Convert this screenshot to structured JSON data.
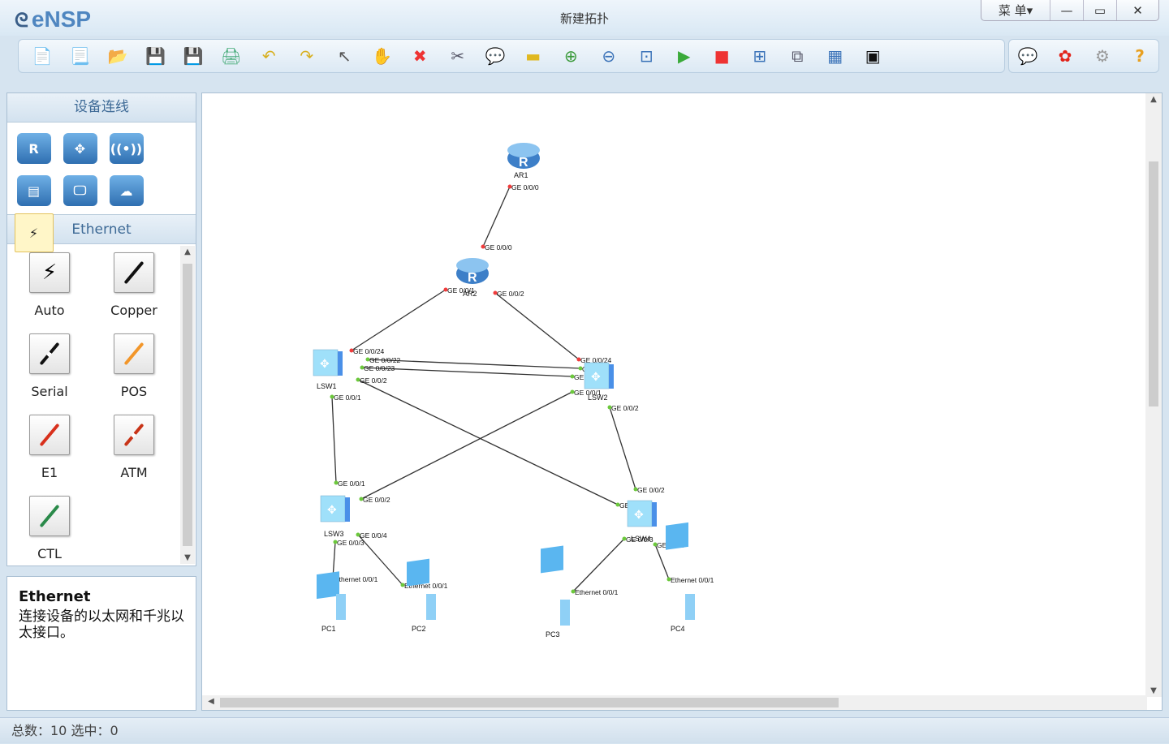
{
  "window": {
    "app_name": "eNSP",
    "title": "新建拓扑",
    "menu_label": "菜 单▾",
    "minimize": "—",
    "maximize": "▭",
    "close": "✕"
  },
  "toolbar": {
    "items": [
      {
        "name": "new-topology-icon",
        "glyph": "📄",
        "color": "#4a7"
      },
      {
        "name": "new-template-icon",
        "glyph": "📃",
        "color": "#4a7"
      },
      {
        "name": "open-icon",
        "glyph": "📂",
        "color": "#d9a93c"
      },
      {
        "name": "save-icon",
        "glyph": "💾",
        "color": "#3a72b8"
      },
      {
        "name": "save-as-icon",
        "glyph": "💾",
        "color": "#3a72b8"
      },
      {
        "name": "print-icon",
        "glyph": "🖨",
        "color": "#4a7"
      },
      {
        "name": "undo-icon",
        "glyph": "↶",
        "color": "#d8b020"
      },
      {
        "name": "redo-icon",
        "glyph": "↷",
        "color": "#d8b020"
      },
      {
        "name": "select-pointer-icon",
        "glyph": "↖",
        "color": "#555"
      },
      {
        "name": "hand-pan-icon",
        "glyph": "✋",
        "color": "#d9a070"
      },
      {
        "name": "delete-icon",
        "glyph": "✖",
        "color": "#e33"
      },
      {
        "name": "delete-link-icon",
        "glyph": "✂",
        "color": "#556"
      },
      {
        "name": "text-note-icon",
        "glyph": "💬",
        "color": "#58a"
      },
      {
        "name": "rectangle-icon",
        "glyph": "▬",
        "color": "#e0b820"
      },
      {
        "name": "zoom-in-icon",
        "glyph": "⊕",
        "color": "#3a9a3a"
      },
      {
        "name": "zoom-out-icon",
        "glyph": "⊖",
        "color": "#3a72b8"
      },
      {
        "name": "fit-view-icon",
        "glyph": "⊡",
        "color": "#3a72b8"
      },
      {
        "name": "start-device-icon",
        "glyph": "▶",
        "color": "#3aaa3a"
      },
      {
        "name": "stop-device-icon",
        "glyph": "■",
        "color": "#e33"
      },
      {
        "name": "capture-icon",
        "glyph": "⊞",
        "color": "#3a72b8"
      },
      {
        "name": "topology-tree-icon",
        "glyph": "⧉",
        "color": "#556"
      },
      {
        "name": "grid-icon",
        "glyph": "▦",
        "color": "#3a72b8"
      },
      {
        "name": "terminal-icon",
        "glyph": "▣",
        "color": "#111"
      }
    ],
    "right_items": [
      {
        "name": "chat-icon",
        "glyph": "💬",
        "color": "#58a"
      },
      {
        "name": "huawei-icon",
        "glyph": "✿",
        "color": "#e2231a"
      },
      {
        "name": "settings-gear-icon",
        "glyph": "⚙",
        "color": "#999"
      },
      {
        "name": "help-icon",
        "glyph": "?",
        "color": "#e8a020"
      }
    ]
  },
  "left_panel": {
    "title": "设备连线",
    "categories": [
      {
        "name": "router",
        "glyph": "R"
      },
      {
        "name": "switch",
        "glyph": "✥"
      },
      {
        "name": "wireless",
        "glyph": "((•))"
      },
      {
        "name": "firewall",
        "glyph": "▤"
      },
      {
        "name": "terminal",
        "glyph": "🖵"
      },
      {
        "name": "cloud",
        "glyph": "☁"
      },
      {
        "name": "cable",
        "glyph": "⚡"
      }
    ],
    "section_title": "Ethernet",
    "cables": [
      {
        "label": "Auto",
        "color": "#111"
      },
      {
        "label": "Copper",
        "color": "#111"
      },
      {
        "label": "Serial",
        "color": "#111"
      },
      {
        "label": "POS",
        "color": "#f2962a"
      },
      {
        "label": "E1",
        "color": "#d8301c"
      },
      {
        "label": "ATM",
        "color": "#c83418"
      },
      {
        "label": "CTL",
        "color": "#2a8a4a"
      }
    ],
    "description": {
      "title": "Ethernet",
      "text": "连接设备的以太网和千兆以太接口。"
    }
  },
  "topology": {
    "devices": [
      {
        "id": "AR1",
        "type": "router"
      },
      {
        "id": "AR2",
        "type": "router"
      },
      {
        "id": "LSW1",
        "type": "switch"
      },
      {
        "id": "LSW2",
        "type": "switch"
      },
      {
        "id": "LSW3",
        "type": "switch"
      },
      {
        "id": "LSW4",
        "type": "switch"
      },
      {
        "id": "PC1",
        "type": "pc"
      },
      {
        "id": "PC2",
        "type": "pc"
      },
      {
        "id": "PC3",
        "type": "pc"
      },
      {
        "id": "PC4",
        "type": "pc"
      }
    ],
    "links": [
      {
        "a": "AR1",
        "a_port": "GE 0/0/0",
        "b": "AR2",
        "b_port": "GE 0/0/0",
        "status": "down"
      },
      {
        "a": "AR2",
        "a_port": "GE 0/0/1",
        "b": "LSW1",
        "b_port": "GE 0/0/24",
        "status": "down"
      },
      {
        "a": "AR2",
        "a_port": "GE 0/0/2",
        "b": "LSW2",
        "b_port": "GE 0/0/24",
        "status": "down"
      },
      {
        "a": "LSW1",
        "a_port": "GE 0/0/22",
        "b": "LSW2",
        "b_port": "GE 0/0/22",
        "status": "up"
      },
      {
        "a": "LSW1",
        "a_port": "GE 0/0/23",
        "b": "LSW2",
        "b_port": "GE 0/0/23",
        "status": "up"
      },
      {
        "a": "LSW1",
        "a_port": "GE 0/0/2",
        "b": "LSW4",
        "b_port": "GE 0/0/1",
        "status": "up"
      },
      {
        "a": "LSW1",
        "a_port": "GE 0/0/1",
        "b": "LSW3",
        "b_port": "GE 0/0/1",
        "status": "up"
      },
      {
        "a": "LSW2",
        "a_port": "GE 0/0/1",
        "b": "LSW3",
        "b_port": "GE 0/0/2",
        "status": "up"
      },
      {
        "a": "LSW2",
        "a_port": "GE 0/0/2",
        "b": "LSW4",
        "b_port": "GE 0/0/2",
        "status": "up"
      },
      {
        "a": "LSW3",
        "a_port": "GE 0/0/3",
        "b": "PC1",
        "b_port": "Ethernet 0/0/1",
        "status": "up"
      },
      {
        "a": "LSW3",
        "a_port": "GE 0/0/4",
        "b": "PC2",
        "b_port": "Ethernet 0/0/1",
        "status": "up"
      },
      {
        "a": "LSW4",
        "a_port": "GE 0/0/3",
        "b": "PC3",
        "b_port": "Ethernet 0/0/1",
        "status": "up"
      },
      {
        "a": "LSW4",
        "a_port": "GE 0/0/4",
        "b": "PC4",
        "b_port": "Ethernet 0/0/1",
        "status": "up"
      }
    ],
    "colors": {
      "up": "#6cc83c",
      "down": "#f03c3c",
      "link": "#333333",
      "label": "#c05a10"
    }
  },
  "status": {
    "text": "总数：10  选中：0"
  }
}
